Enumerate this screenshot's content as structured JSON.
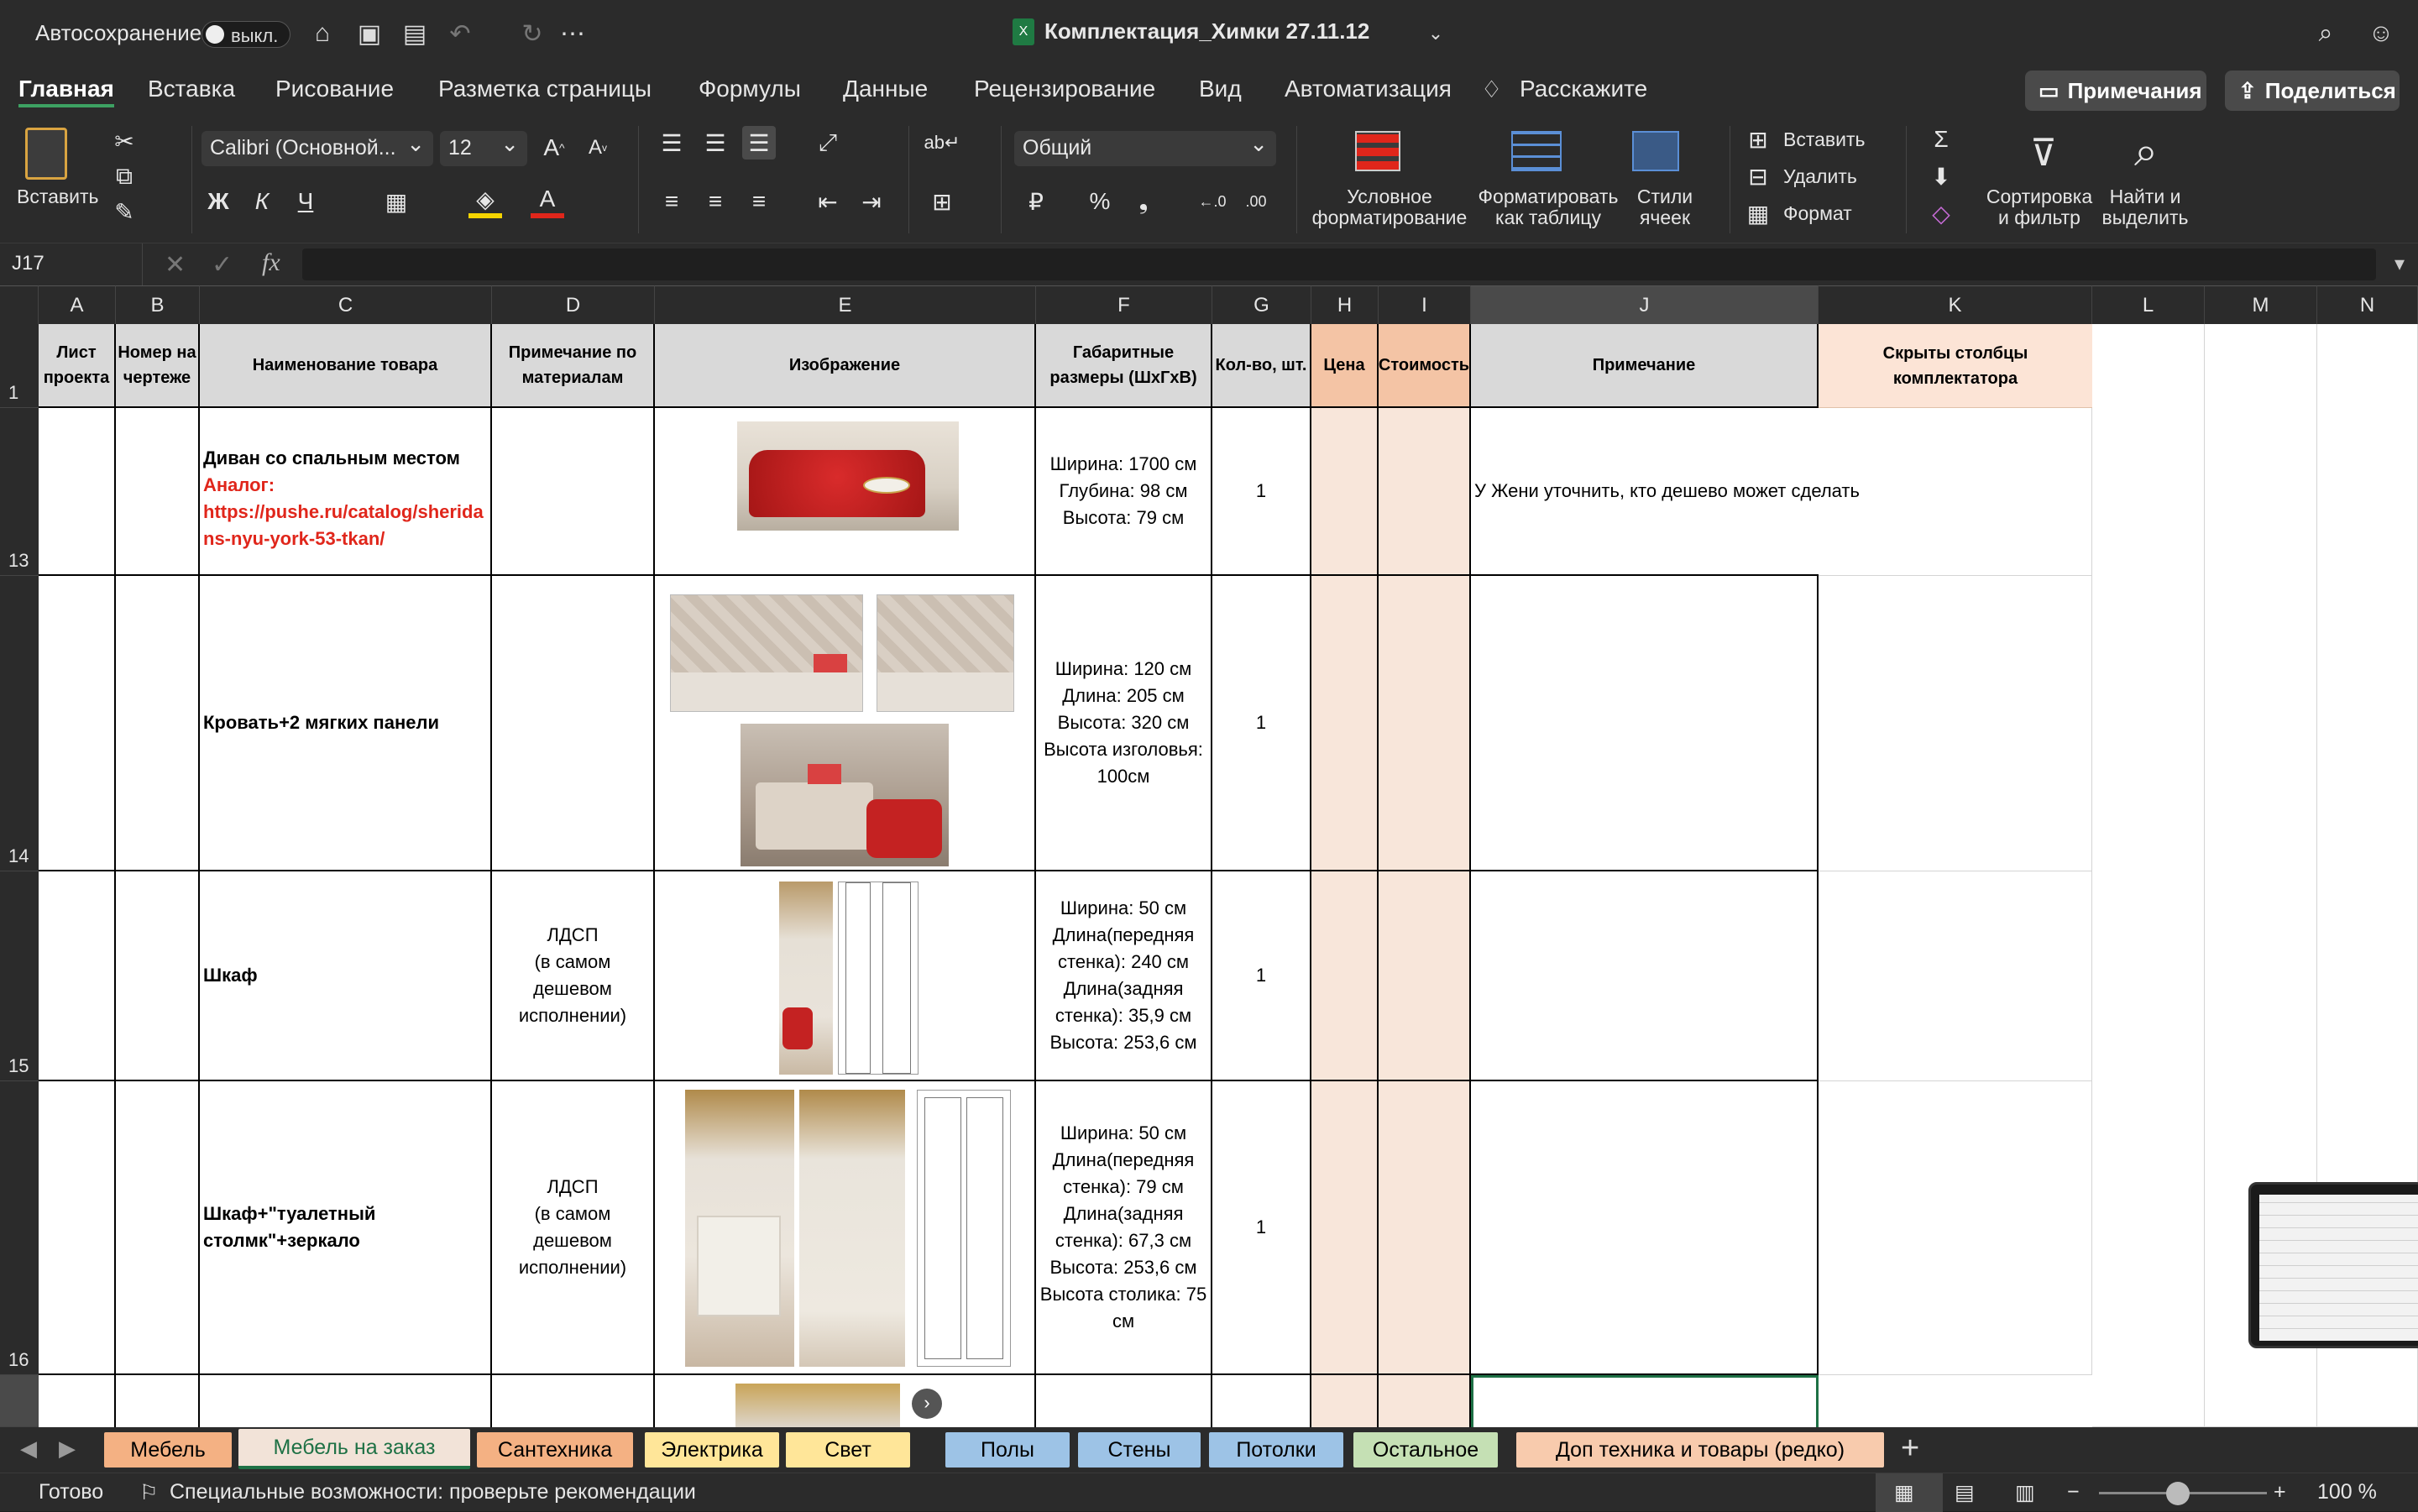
{
  "app": {
    "autosave_label": "Автосохранение",
    "autosave_state": "выкл.",
    "doc_title": "Комплектация_Химки 27.11.12"
  },
  "menu": [
    "Главная",
    "Вставка",
    "Рисование",
    "Разметка страницы",
    "Формулы",
    "Данные",
    "Рецензирование",
    "Вид",
    "Автоматизация",
    "Расскажите"
  ],
  "menu_right": {
    "comments": "Примечания",
    "share": "Поделиться"
  },
  "ribbon": {
    "paste": "Вставить",
    "font_name": "Calibri (Основной...",
    "font_size": "12",
    "bold": "Ж",
    "italic": "К",
    "underline": "Ч",
    "number_format": "Общий",
    "conditional": [
      "Условное",
      "форматирование"
    ],
    "format_table": [
      "Форматировать",
      "как таблицу"
    ],
    "cell_styles": [
      "Стили",
      "ячеек"
    ],
    "insert": "Вставить",
    "delete": "Удалить",
    "format": "Формат",
    "sort": [
      "Сортировка",
      "и фильтр"
    ],
    "find": [
      "Найти и",
      "выделить"
    ]
  },
  "formula_bar": {
    "name_box": "J17",
    "fx": "fx",
    "formula": ""
  },
  "columns": [
    "A",
    "B",
    "C",
    "D",
    "E",
    "F",
    "G",
    "H",
    "I",
    "J",
    "K",
    "L",
    "M",
    "N"
  ],
  "headers": {
    "A": "Лист проекта",
    "B": "Номер на чертеже",
    "C": "Наименование товара",
    "D": "Примечание по материалам",
    "E": "Изображение",
    "F": "Габаритные размеры (ШхГхВ)",
    "G": "Кол-во, шт.",
    "H": "Цена",
    "I": "Стоимость",
    "J": "Примечание",
    "K": "Скрыты столбцы комплектатора"
  },
  "rows": [
    {
      "num": "13",
      "name": "Диван со спальным местом",
      "analog_label": "Аналог:",
      "analog_url": "https://pushe.ru/catalog/sheridans-nyu-york-53-tkan/",
      "material": [],
      "dims": [
        "Ширина: 1700 см",
        "Глубина: 98 см",
        "Высота: 79 см"
      ],
      "qty": "1",
      "note": "У Жени уточнить, кто дешево может сделать"
    },
    {
      "num": "14",
      "name": "Кровать+2 мягких панели",
      "material": [],
      "dims": [
        "Ширина: 120 см",
        "Длина: 205 см",
        "Высота: 320 см",
        "Высота изголовья:",
        "100см"
      ],
      "qty": "1",
      "note": ""
    },
    {
      "num": "15",
      "name": "Шкаф",
      "material": [
        "ЛДСП",
        "(в самом",
        "дешевом",
        "исполнении)"
      ],
      "dims": [
        "Ширина: 50 см",
        "Длина(передняя",
        "стенка): 240 см",
        "Длина(задняя",
        "стенка): 35,9 см",
        "Высота: 253,6 см"
      ],
      "qty": "1",
      "note": ""
    },
    {
      "num": "16",
      "name": "Шкаф+\"туалетный столмк\"+зеркало",
      "material": [
        "ЛДСП",
        "(в самом",
        "дешевом",
        "исполнении)"
      ],
      "dims": [
        "Ширина: 50 см",
        "Длина(передняя",
        "стенка): 79 см",
        "Длина(задняя",
        "стенка): 67,3 см",
        "Высота: 253,6 см",
        "Высота столика: 75",
        "см"
      ],
      "qty": "1",
      "note": ""
    }
  ],
  "sheets": [
    {
      "name": "Мебель",
      "color": "#f4b183"
    },
    {
      "name": "Мебель на заказ",
      "color": "#f2e3d8",
      "active": true
    },
    {
      "name": "Сантехника",
      "color": "#f4b183"
    },
    {
      "name": "Электрика",
      "color": "#ffe699"
    },
    {
      "name": "Свет",
      "color": "#ffe699"
    },
    {
      "name": "Полы",
      "color": "#9dc3e6"
    },
    {
      "name": "Стены",
      "color": "#9dc3e6"
    },
    {
      "name": "Потолки",
      "color": "#9dc3e6"
    },
    {
      "name": "Остальное",
      "color": "#c5e0b4"
    },
    {
      "name": "Доп техника и товары (редко)",
      "color": "#f8cbad"
    }
  ],
  "status": {
    "ready": "Готово",
    "accessibility": "Специальные возможности: проверьте рекомендации",
    "zoom": "100 %"
  }
}
